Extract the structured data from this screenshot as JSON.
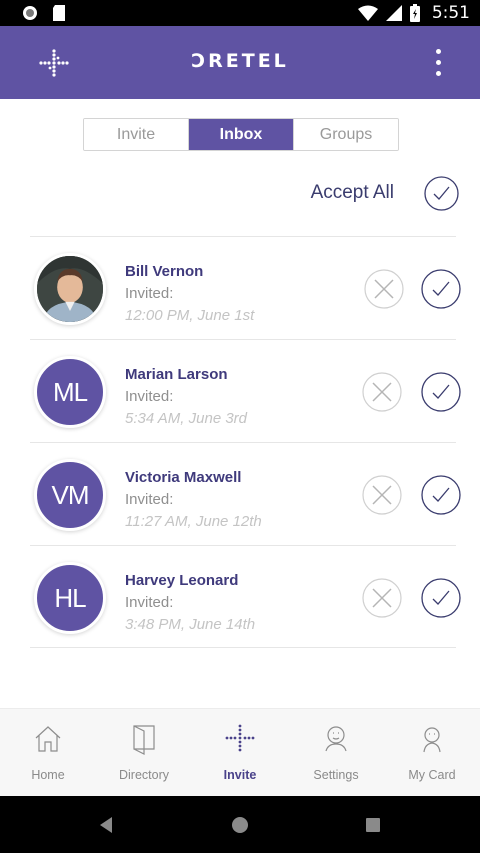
{
  "status_bar": {
    "time": "5:51"
  },
  "app_bar": {
    "title": "ƆRETEL"
  },
  "tabs": [
    {
      "label": "Invite",
      "active": false
    },
    {
      "label": "Inbox",
      "active": true
    },
    {
      "label": "Groups",
      "active": false
    }
  ],
  "accept_all": {
    "label": "Accept All"
  },
  "invites": [
    {
      "name": "Bill Vernon",
      "initials": "",
      "status": "Invited:",
      "time": "12:00 PM, June 1st"
    },
    {
      "name": "Marian Larson",
      "initials": "ML",
      "status": "Invited:",
      "time": "5:34 AM, June 3rd"
    },
    {
      "name": "Victoria Maxwell",
      "initials": "VM",
      "status": "Invited:",
      "time": "11:27 AM, June 12th"
    },
    {
      "name": "Harvey Leonard",
      "initials": "HL",
      "status": "Invited:",
      "time": "3:48 PM, June 14th"
    }
  ],
  "bottom_nav": [
    {
      "label": "Home",
      "icon": "home-icon",
      "active": false
    },
    {
      "label": "Directory",
      "icon": "directory-icon",
      "active": false
    },
    {
      "label": "Invite",
      "icon": "invite-icon",
      "active": true
    },
    {
      "label": "Settings",
      "icon": "settings-icon",
      "active": false
    },
    {
      "label": "My Card",
      "icon": "my-card-icon",
      "active": false
    }
  ],
  "colors": {
    "brand": "#5f53a3",
    "name_text": "#3f3a7c",
    "accept_stroke": "#3a3c6e"
  }
}
